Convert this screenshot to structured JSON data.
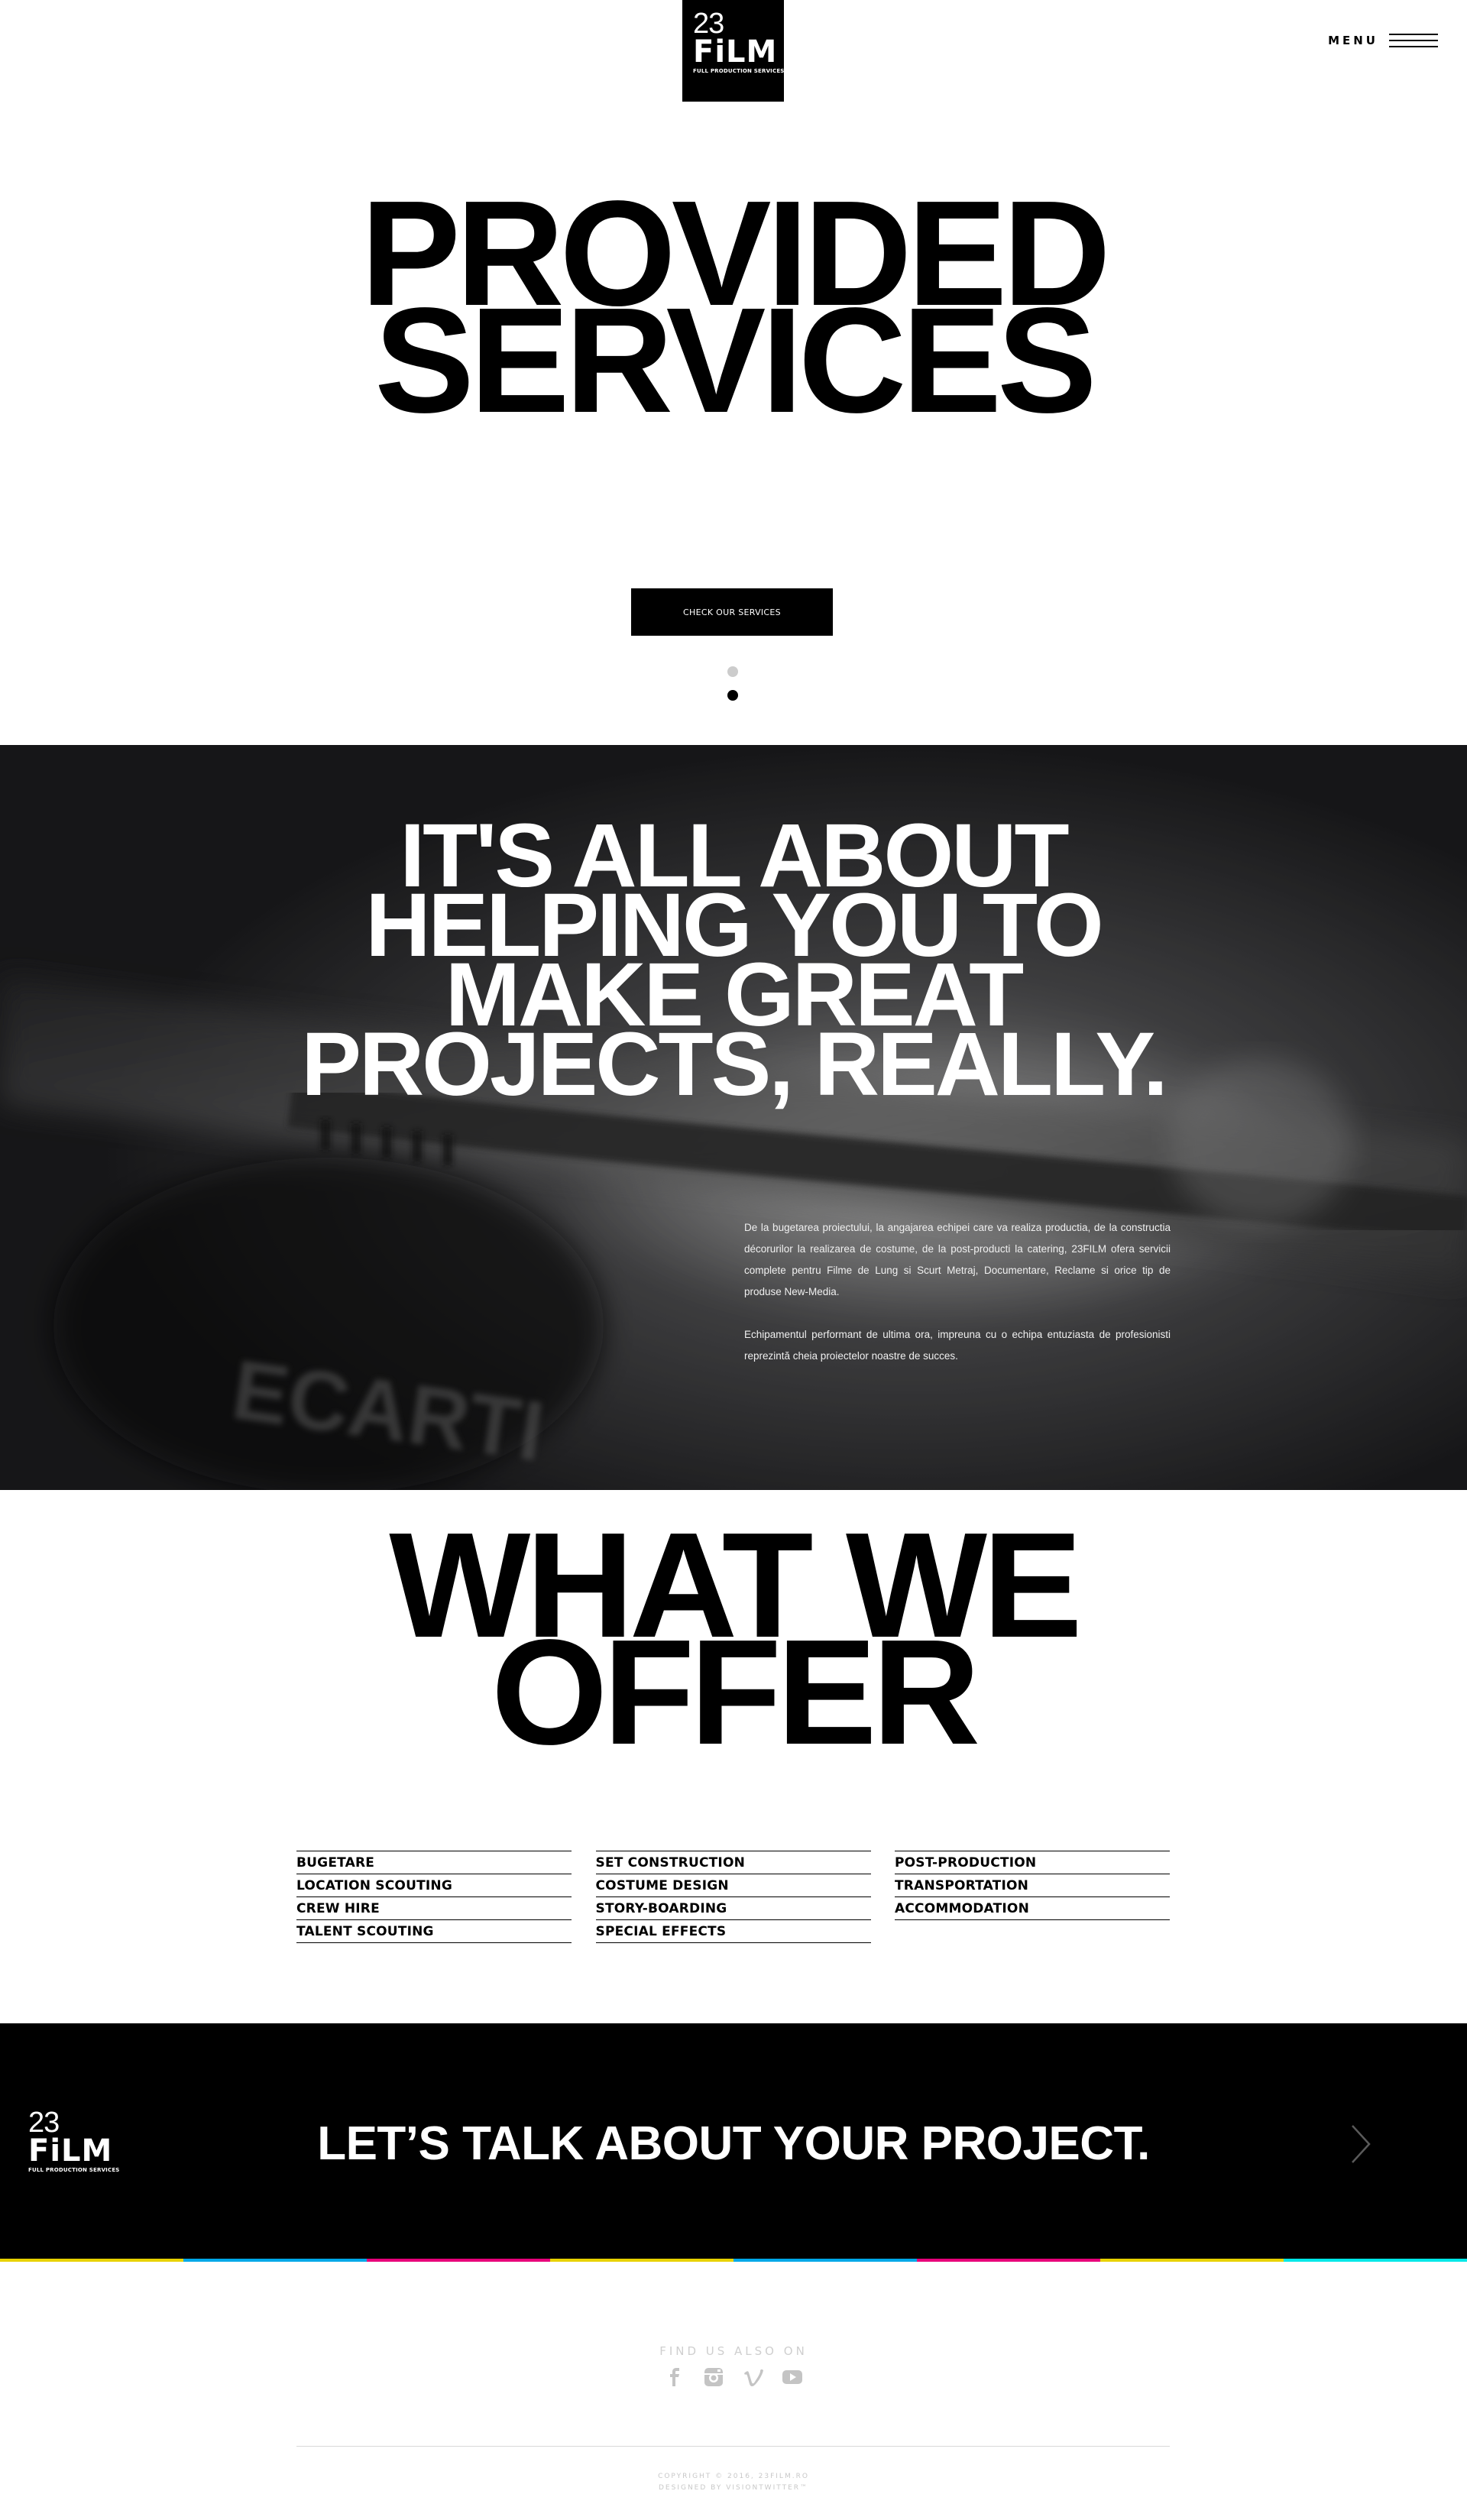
{
  "brand": {
    "number": "23",
    "word": "FiLM",
    "tagline": "FULL PRODUCTION SERVICES"
  },
  "header": {
    "menu_label": "MENU"
  },
  "hero": {
    "title_line1": "PROVIDED",
    "title_line2": "SERVICES",
    "cta_label": "CHECK OUR SERVICES",
    "slide_count": 2,
    "active_slide": 2
  },
  "about": {
    "title_lines": [
      "IT'S ALL ABOUT",
      "HELPING YOU TO",
      "MAKE GREAT",
      "PROJECTS, REALLY."
    ],
    "paragraph1": "De la bugetarea proiectului, la angajarea echipei care va realiza productia, de la constructia  décorurilor  la realizarea de costume, de la post-producti  la catering, 23FILM ofera servicii complete pentru Filme  de Lung si Scurt Metraj, Documentare, Reclame si orice tip de produse New-Media.",
    "paragraph2": "Echipamentul performant de ultima ora, impreuna cu o echipa entuziasta de profesionisti reprezintă cheia proiectelor noastre de succes."
  },
  "offer": {
    "title_line1": "WHAT WE",
    "title_line2": "OFFER",
    "columns": [
      [
        "BUGETARE",
        "LOCATION SCOUTING",
        "CREW HIRE",
        "TALENT SCOUTING"
      ],
      [
        "SET CONSTRUCTION",
        "COSTUME DESIGN",
        "STORY-BOARDING",
        "SPECIAL EFFECTS"
      ],
      [
        "POST-PRODUCTION",
        "TRANSPORTATION",
        "ACCOMMODATION"
      ]
    ]
  },
  "contact": {
    "title": "LET’S TALK ABOUT YOUR PROJECT.",
    "arrow_icon": "chevron-right-icon",
    "strip_colors": [
      "#e8d200",
      "#00a8e8",
      "#e8007a",
      "#e8d200",
      "#00a8e8",
      "#e8007a",
      "#e8d200",
      "#00e8e8"
    ]
  },
  "footer": {
    "find_us_label": "FIND US ALSO ON",
    "social": [
      "facebook-icon",
      "instagram-icon",
      "vimeo-icon",
      "youtube-icon"
    ],
    "copyright": "COPYRIGHT © 2016, 23FILM.RO",
    "designed_by": "DESIGNED BY VISIONTWITTER™"
  },
  "colors": {
    "background": "#ffffff",
    "ink": "#000000",
    "muted": "#cfcfcf"
  }
}
